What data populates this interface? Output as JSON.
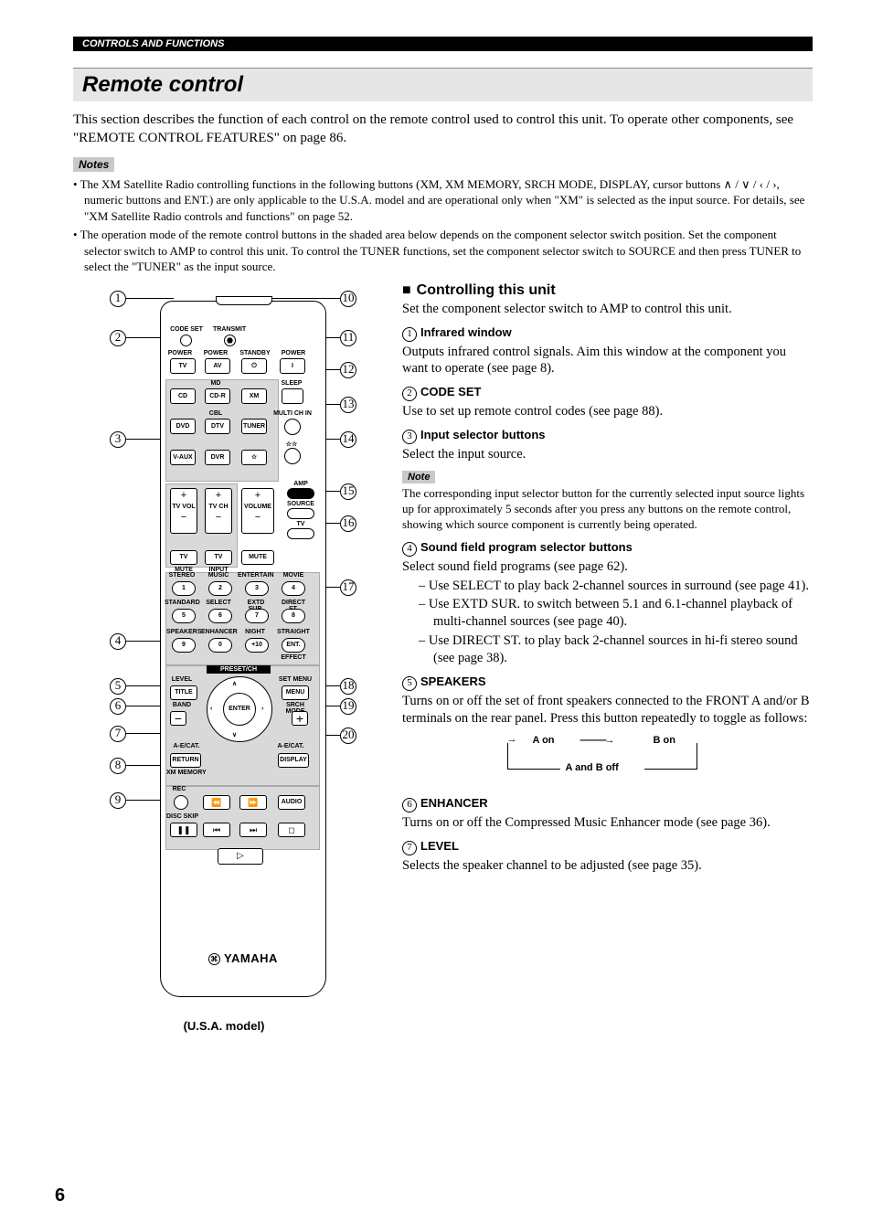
{
  "header": {
    "section": "CONTROLS AND FUNCTIONS"
  },
  "title": "Remote control",
  "intro": "This section describes the function of each control on the remote control used to control this unit. To operate other components, see \"REMOTE CONTROL FEATURES\" on page 86.",
  "notes_label": "Notes",
  "notes": [
    "The XM Satellite Radio controlling functions in the following buttons (XM, XM MEMORY, SRCH MODE, DISPLAY, cursor buttons ∧ / ∨ / ‹ / ›, numeric buttons and ENT.) are only applicable to the U.S.A. model and are operational only when \"XM\" is selected as the input source. For details, see \"XM Satellite Radio controls and functions\" on page 52.",
    "The operation mode of the remote control buttons in the shaded area below depends on the component selector switch position. Set the component selector switch to AMP to control this unit. To control the TUNER functions, set the component selector switch to SOURCE and then press TUNER to select the \"TUNER\" as the input source."
  ],
  "remote": {
    "caption": "(U.S.A. model)",
    "brand": "YAMAHA",
    "callouts_left": [
      "1",
      "2",
      "3",
      "4",
      "5",
      "6",
      "7",
      "8",
      "9"
    ],
    "callouts_right": [
      "10",
      "11",
      "12",
      "13",
      "14",
      "15",
      "16",
      "17",
      "18",
      "19",
      "20"
    ],
    "labels": {
      "code_set": "CODE SET",
      "transmit": "TRANSMIT",
      "power": "POWER",
      "standby": "STANDBY",
      "tv": "TV",
      "av": "AV",
      "md": "MD",
      "sleep": "SLEEP",
      "cd": "CD",
      "cdr": "CD-R",
      "xm": "XM",
      "cbl": "CBL",
      "multi": "MULTI CH IN",
      "dvd": "DVD",
      "dtv": "DTV",
      "tuner": "TUNER",
      "vaux": "V-AUX",
      "dvr": "DVR",
      "tvvol": "TV VOL",
      "tvch": "TV CH",
      "volume": "VOLUME",
      "amp": "AMP",
      "source": "SOURCE",
      "tv2": "TV",
      "tvmute": "TV MUTE",
      "tvinput": "TV INPUT",
      "mute": "MUTE",
      "stereo": "STEREO",
      "music": "MUSIC",
      "entertain": "ENTERTAIN",
      "movie": "MOVIE",
      "standard": "STANDARD",
      "select": "SELECT",
      "extd": "EXTD SUR.",
      "direct": "DIRECT ST.",
      "speakers": "SPEAKERS",
      "enhancer": "ENHANCER",
      "night": "NIGHT",
      "straight": "STRAIGHT",
      "ent": "ENT.",
      "plus10": "+10",
      "effect": "EFFECT",
      "presetch": "PRESET/CH",
      "level": "LEVEL",
      "setmenu": "SET MENU",
      "title": "TITLE",
      "menu": "MENU",
      "band": "BAND",
      "srch": "SRCH MODE",
      "enter": "ENTER",
      "aecat": "A-E/CAT.",
      "return": "RETURN",
      "display": "DISPLAY",
      "xmmem": "XM MEMORY",
      "rec": "REC",
      "audio": "AUDIO",
      "disc": "DISC SKIP"
    }
  },
  "right": {
    "heading": "Controlling this unit",
    "heading_body": "Set the component selector switch to AMP to control this unit.",
    "items": [
      {
        "num": "1",
        "title": "Infrared window",
        "body": "Outputs infrared control signals. Aim this window at the component you want to operate (see page 8)."
      },
      {
        "num": "2",
        "title": "CODE SET",
        "body": "Use to set up remote control codes (see page 88)."
      },
      {
        "num": "3",
        "title": "Input selector buttons",
        "body": "Select the input source."
      }
    ],
    "note_label": "Note",
    "note_body": "The corresponding input selector button for the currently selected input source lights up for approximately 5 seconds after you press any buttons on the remote control, showing which source component is currently being operated.",
    "item4": {
      "num": "4",
      "title": "Sound field program selector buttons",
      "body": "Select sound field programs (see page 62).",
      "bullets": [
        "Use SELECT to play back 2-channel sources in surround (see page 41).",
        "Use EXTD SUR. to switch between 5.1 and 6.1-channel playback of multi-channel sources (see page 40).",
        "Use DIRECT ST. to play back 2-channel sources in hi-fi stereo sound (see page 38)."
      ]
    },
    "item5": {
      "num": "5",
      "title": "SPEAKERS",
      "body": "Turns on or off the set of front speakers connected to the FRONT A and/or B terminals on the rear panel. Press this button repeatedly to toggle as follows:",
      "diagram": {
        "a": "A on",
        "b": "B on",
        "off": "A and B off"
      }
    },
    "item6": {
      "num": "6",
      "title": "ENHANCER",
      "body": "Turns on or off the Compressed Music Enhancer mode (see page 36)."
    },
    "item7": {
      "num": "7",
      "title": "LEVEL",
      "body": "Selects the speaker channel to be adjusted (see page 35)."
    }
  },
  "page_number": "6"
}
